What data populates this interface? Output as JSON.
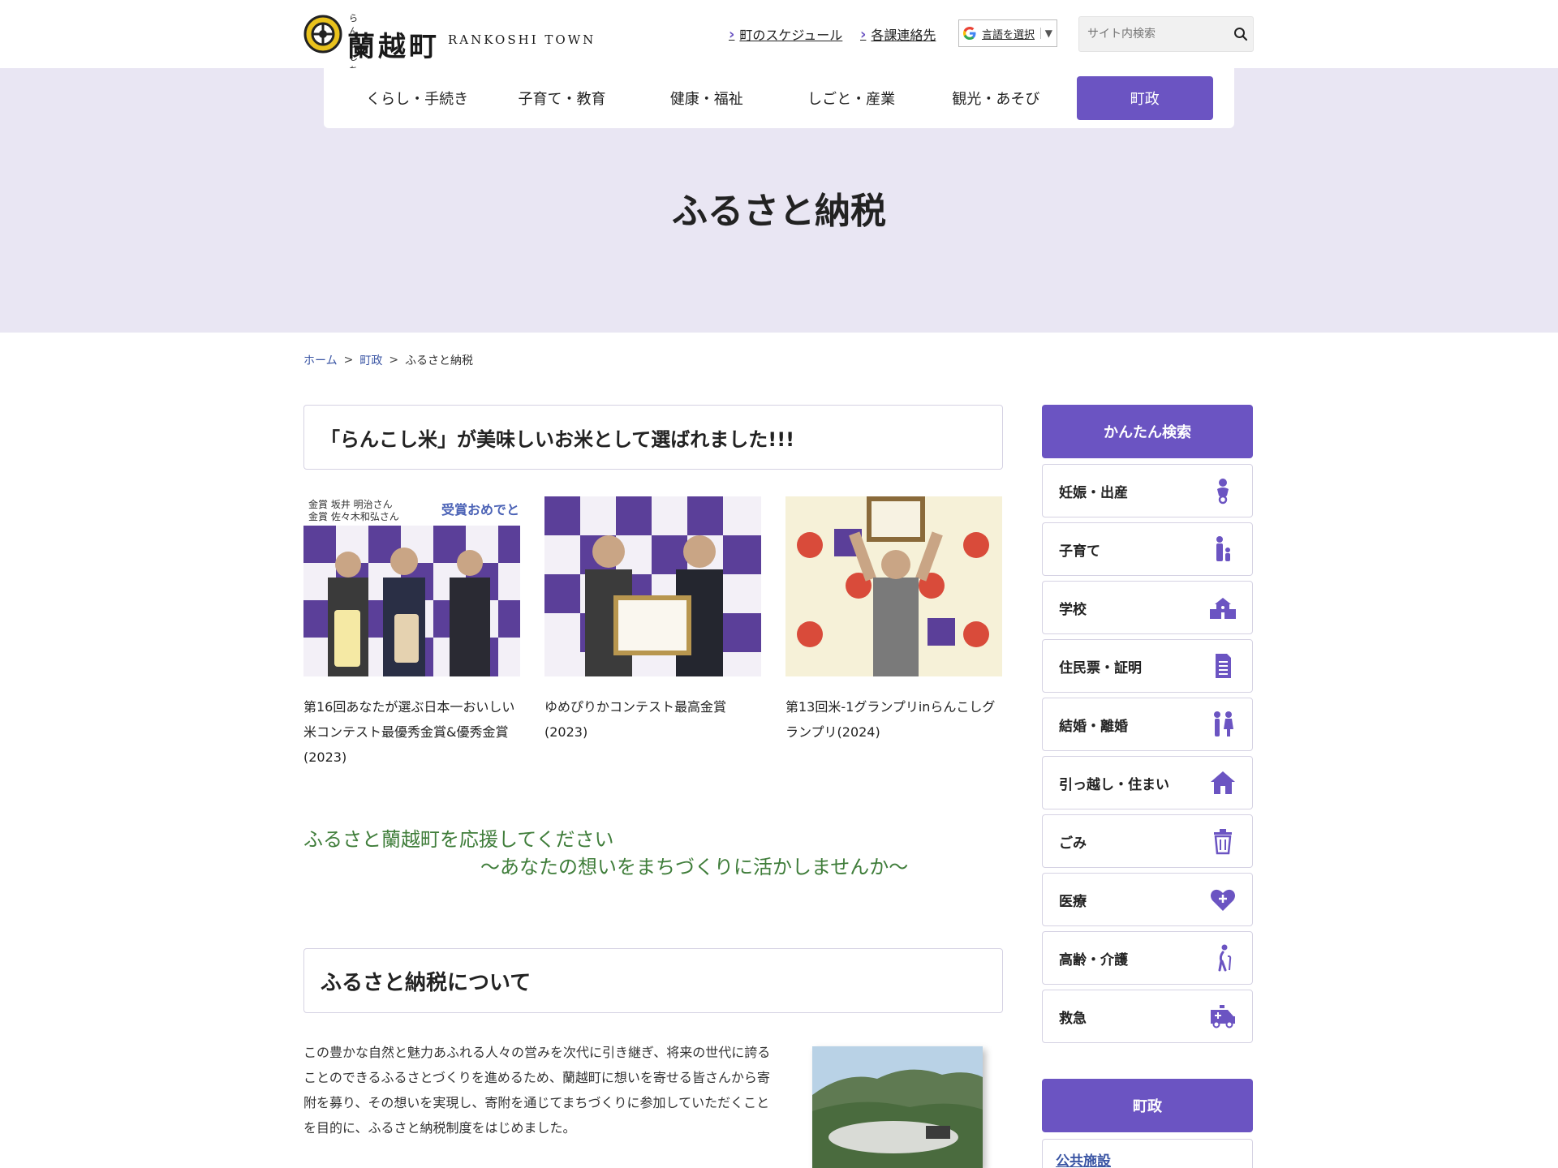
{
  "header": {
    "logo_ruby": "らんこしちょう",
    "logo_kanji": "蘭越町",
    "logo_en": "RANKOSHI TOWN",
    "link_schedule": "町のスケジュール",
    "link_contacts": "各課連絡先",
    "lang_label": "言語を選択",
    "lang_arrow": "▼",
    "search_placeholder": "サイト内検索"
  },
  "nav": {
    "items": [
      {
        "label": "くらし・手続き"
      },
      {
        "label": "子育て・教育"
      },
      {
        "label": "健康・福祉"
      },
      {
        "label": "しごと・産業"
      },
      {
        "label": "観光・あそび"
      },
      {
        "label": "町政"
      }
    ],
    "active_color": "#6b54c2"
  },
  "hero": {
    "title": "ふるさと納税"
  },
  "breadcrumb": {
    "home": "ホーム",
    "sep": ">",
    "parent": "町政",
    "current": "ふるさと納税"
  },
  "main": {
    "section1_title": "「らんこし米」が美味しいお米として選ばれました!!!",
    "photos": [
      {
        "caption": "第16回あなたが選ぶ日本一おいしい米コンテスト最優秀金賞&優秀金賞(2023)"
      },
      {
        "caption": "ゆめぴりかコンテスト最高金賞(2023)"
      },
      {
        "caption": "第13回米-1グランプリinらんこしグランプリ(2024)"
      }
    ],
    "photo1_banner": "受賞おめでと",
    "photo1_names": "金賞 坂井 明治さん / 金賞 佐々木和弘さん",
    "slogan_line1": "ふるさと蘭越町を応援してください",
    "slogan_line2": "～あなたの想いをまちづくりに活かしませんか～",
    "section2_title": "ふるさと納税について",
    "body_text": "この豊かな自然と魅力あふれる人々の営みを次代に引き継ぎ、将来の世代に誇ることのできるふるさとづくりを進めるため、蘭越町に想いを寄せる皆さんから寄附を募り、その想いを実現し、寄附を通じてまちづくりに参加していただくことを目的に、ふるさと納税制度をはじめました。"
  },
  "sidebar": {
    "quick_search_title": "かんたん検索",
    "items": [
      {
        "label": "妊娠・出産",
        "icon": "baby-icon"
      },
      {
        "label": "子育て",
        "icon": "parent-child-icon"
      },
      {
        "label": "学校",
        "icon": "school-icon"
      },
      {
        "label": "住民票・証明",
        "icon": "document-icon"
      },
      {
        "label": "結婚・離婚",
        "icon": "couple-icon"
      },
      {
        "label": "引っ越し・住まい",
        "icon": "house-icon"
      },
      {
        "label": "ごみ",
        "icon": "trash-icon"
      },
      {
        "label": "医療",
        "icon": "medical-heart-icon"
      },
      {
        "label": "高齢・介護",
        "icon": "elderly-icon"
      },
      {
        "label": "救急",
        "icon": "ambulance-icon"
      }
    ],
    "town_title": "町政",
    "town_first_item": "公共施設",
    "accent_color": "#6b54c2"
  }
}
